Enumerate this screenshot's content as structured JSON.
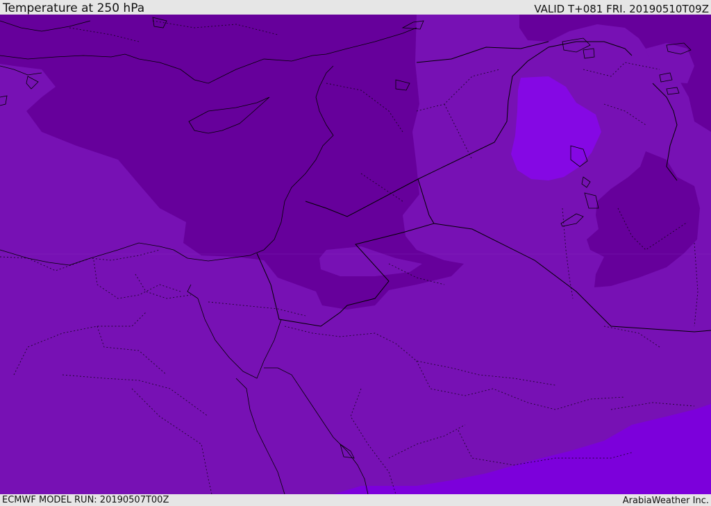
{
  "header": {
    "title": "Temperature at 250 hPa",
    "valid": "VALID T+081 FRI. 20190510T09Z"
  },
  "footer": {
    "model_run": "ECMWF MODEL RUN: 20190507T00Z",
    "credit": "ArabiaWeather Inc."
  },
  "map": {
    "colors": {
      "base": "#7711b4",
      "cold": "#66009b",
      "warm": "#7c00db",
      "warm_light": "#8508e4",
      "border": "#000000"
    }
  }
}
